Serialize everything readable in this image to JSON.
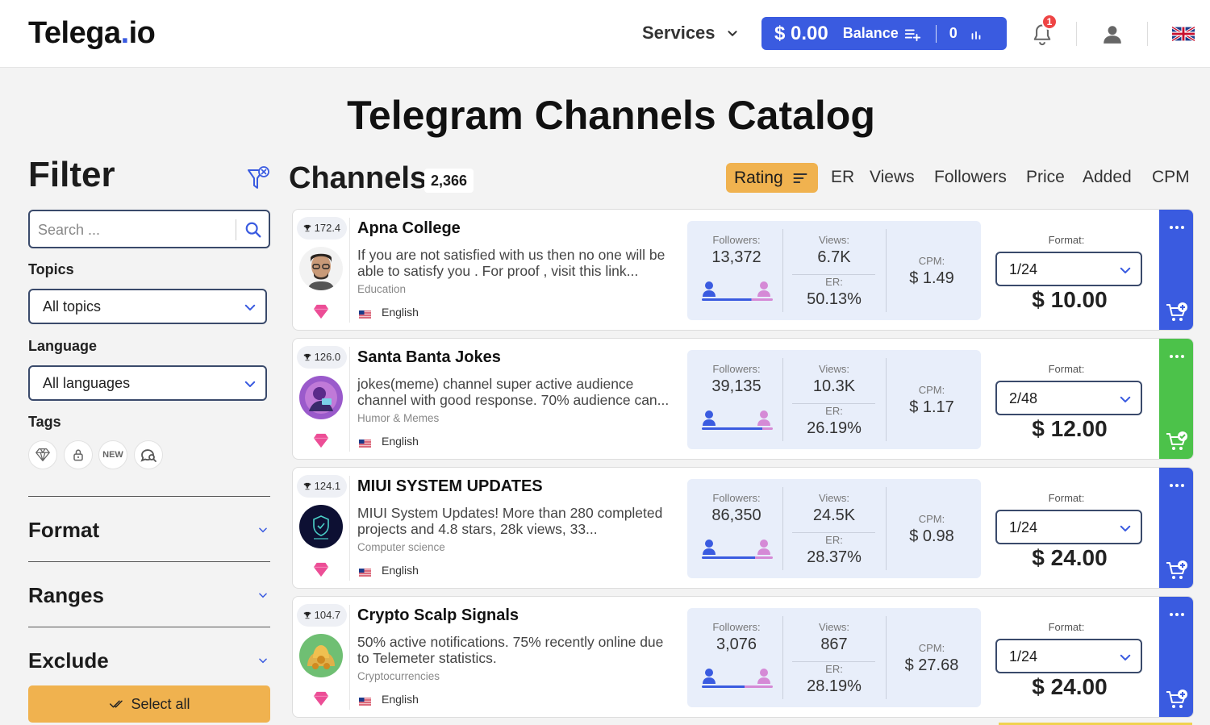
{
  "header": {
    "logo_text": "Telega",
    "logo_dot": ".",
    "logo_suffix": "io",
    "services_label": "Services",
    "balance_amount": "$ 0.00",
    "balance_label": "Balance",
    "balance_zero": "0",
    "notification_count": "1",
    "language_flag": "uk-flag-icon"
  },
  "page_title": "Telegram Channels Catalog",
  "filter": {
    "title": "Filter",
    "search_placeholder": "Search ...",
    "topics_label": "Topics",
    "topics_value": "All topics",
    "language_label": "Language",
    "language_value": "All languages",
    "tags_label": "Tags",
    "tag_new": "NEW",
    "sections": [
      "Format",
      "Ranges",
      "Exclude"
    ],
    "select_all": "Select all"
  },
  "channels": {
    "title": "Channels",
    "count": "2,366",
    "sort_active": "Rating",
    "sort_options": [
      "ER",
      "Views",
      "Followers",
      "Price",
      "Added",
      "CPM"
    ],
    "labels": {
      "followers": "Followers:",
      "views": "Views:",
      "er": "ER:",
      "cpm": "CPM:",
      "format": "Format:"
    },
    "items": [
      {
        "rank": "172.4",
        "name": "Apna College",
        "description": "If you are not satisfied with us then no one will be able to satisfy you . For proof , visit this link...",
        "category": "Education",
        "language": "English",
        "followers": "13,372",
        "views": "6.7K",
        "er": "50.13%",
        "cpm": "$ 1.49",
        "format": "1/24",
        "price": "$ 10.00",
        "male_share": 0.7,
        "action_color": "#3a5be0"
      },
      {
        "rank": "126.0",
        "name": "Santa Banta Jokes",
        "description": "jokes(meme) channel super active audience channel with good response. 70% audience can...",
        "category": "Humor & Memes",
        "language": "English",
        "followers": "39,135",
        "views": "10.3K",
        "er": "26.19%",
        "cpm": "$ 1.17",
        "format": "2/48",
        "price": "$ 12.00",
        "male_share": 0.85,
        "action_color": "#4cc24a"
      },
      {
        "rank": "124.1",
        "name": "MIUI SYSTEM UPDATES",
        "description": "MIUI System Updates! More than 280 completed projects and 4.8 stars, 28k views, 33...",
        "category": "Computer science",
        "language": "English",
        "followers": "86,350",
        "views": "24.5K",
        "er": "28.37%",
        "cpm": "$ 0.98",
        "format": "1/24",
        "price": "$ 24.00",
        "male_share": 0.75,
        "action_color": "#3a5be0"
      },
      {
        "rank": "104.7",
        "name": "Crypto Scalp Signals",
        "description": "50% active notifications. 75% recently online due to Telemeter statistics.",
        "category": "Cryptocurrencies",
        "language": "English",
        "followers": "3,076",
        "views": "867",
        "er": "28.19%",
        "cpm": "$ 27.68",
        "format": "1/24",
        "price": "$ 24.00",
        "male_share": 0.6,
        "action_color": "#3a5be0"
      }
    ]
  }
}
